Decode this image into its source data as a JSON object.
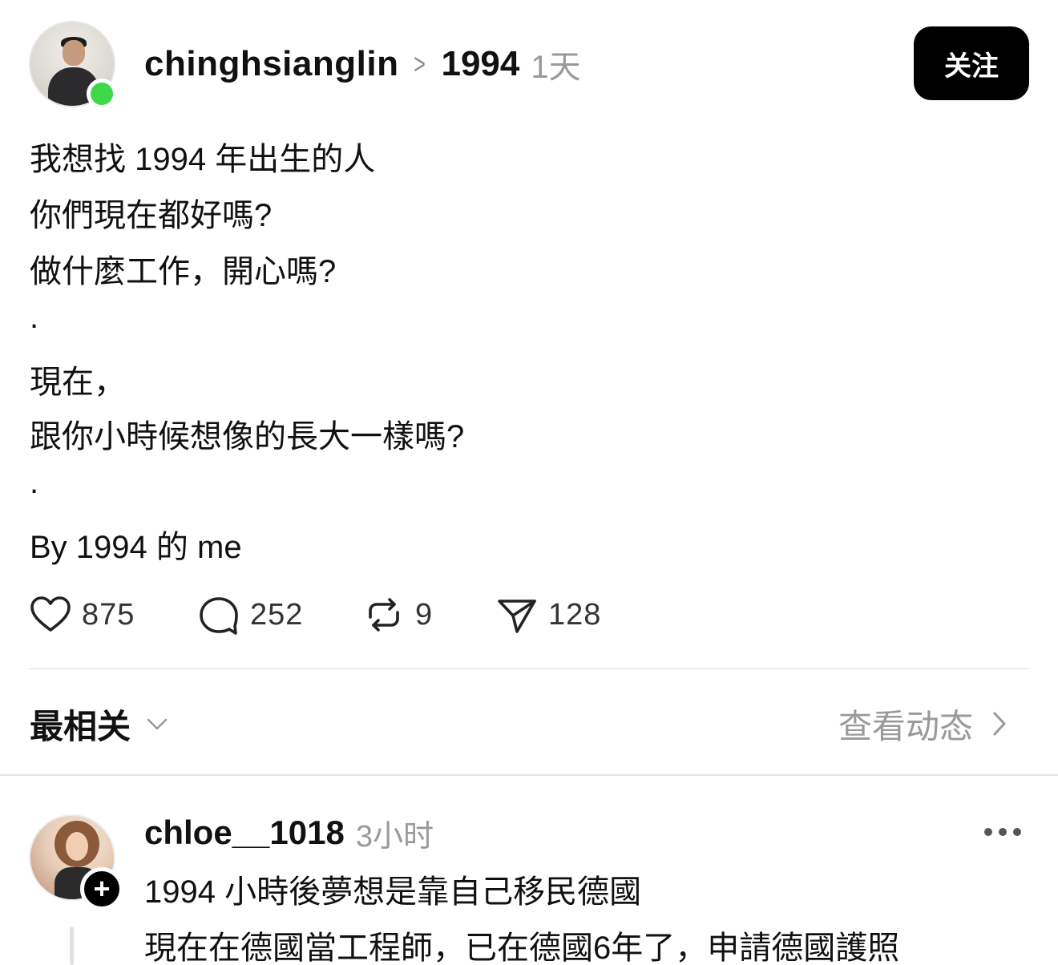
{
  "post": {
    "author": {
      "username": "chinghsianglin",
      "avatar_icon": "profile-photo",
      "online": true,
      "online_color": "#3fd84a"
    },
    "topic": "1994",
    "separator_icon": "chevron-right-icon",
    "time": "1天",
    "follow_label": "关注",
    "lines": [
      "我想找 1994 年出生的人",
      "你們現在都好嗎?",
      "做什麼工作，開心嗎?",
      ".",
      "現在，",
      "跟你小時候想像的長大一樣嗎?",
      ".",
      "By 1994 的 me"
    ],
    "actions": {
      "likes": "875",
      "comments": "252",
      "reposts": "9",
      "shares": "128"
    }
  },
  "replies_bar": {
    "sort_label": "最相关",
    "sort_icon": "chevron-down-icon",
    "activity_label": "查看动态",
    "activity_icon": "chevron-right-icon"
  },
  "reply": {
    "username": "chloe__1018",
    "time": "3小时",
    "follow_badge": "+",
    "more_icon": "ellipsis-icon",
    "lines": [
      "1994 小時後夢想是靠自己移民德國",
      "現在在德國當工程師，已在德國6年了，申請德國護照"
    ]
  }
}
